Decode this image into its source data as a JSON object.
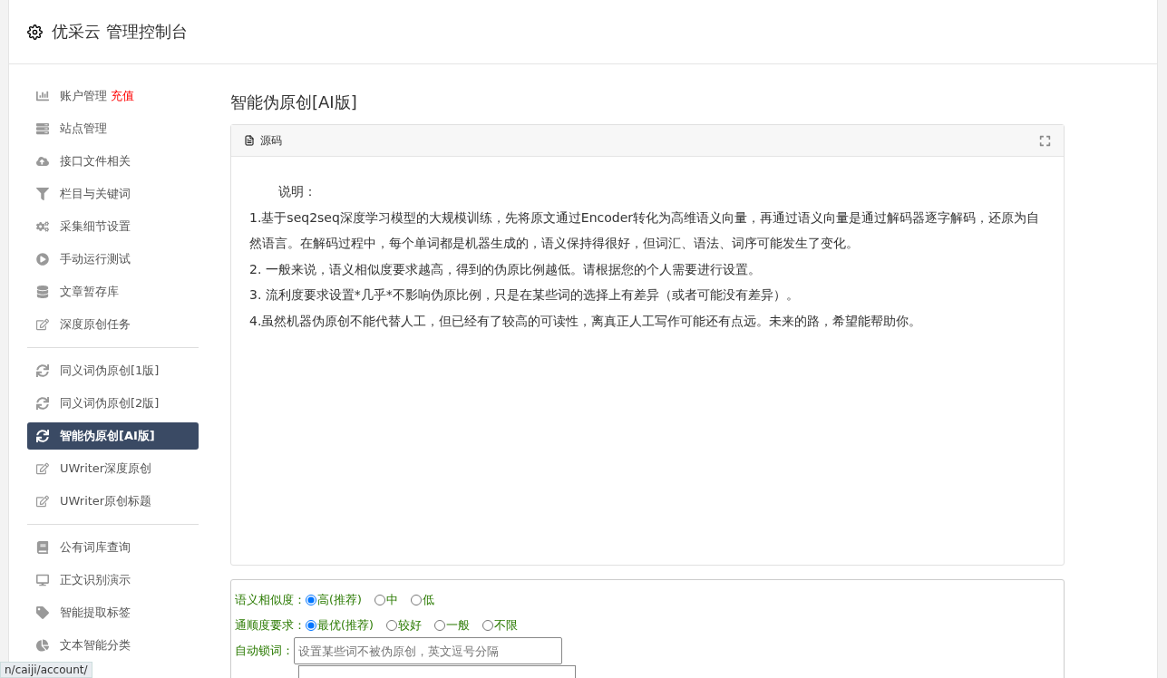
{
  "header": {
    "title": "优采云 管理控制台"
  },
  "sidebar": {
    "groups": [
      {
        "items": [
          {
            "label": "账户管理",
            "badge": "充值",
            "selected": false
          },
          {
            "label": "站点管理",
            "selected": false
          },
          {
            "label": "接口文件相关",
            "selected": false
          },
          {
            "label": "栏目与关键词",
            "selected": false
          },
          {
            "label": "采集细节设置",
            "selected": false
          },
          {
            "label": "手动运行测试",
            "selected": false
          },
          {
            "label": "文章暂存库",
            "selected": false
          },
          {
            "label": "深度原创任务",
            "selected": false
          }
        ]
      },
      {
        "items": [
          {
            "label": "同义词伪原创[1版]",
            "selected": false
          },
          {
            "label": "同义词伪原创[2版]",
            "selected": false
          },
          {
            "label": "智能伪原创[AI版]",
            "selected": true
          },
          {
            "label": "UWriter深度原创",
            "selected": false
          },
          {
            "label": "UWriter原创标题",
            "selected": false
          }
        ]
      },
      {
        "items": [
          {
            "label": "公有词库查询",
            "selected": false
          },
          {
            "label": "正文识别演示",
            "selected": false
          },
          {
            "label": "智能提取标签",
            "selected": false
          },
          {
            "label": "文本智能分类",
            "selected": false
          }
        ]
      }
    ]
  },
  "page_title": "智能伪原创[AI版]",
  "editor": {
    "tab": "源码",
    "lines": [
      "说明：",
      "1.基于seq2seq深度学习模型的大规模训练，先将原文通过Encoder转化为高维语义向量，再通过语义向量是通过解码器逐字解码，还原为自然语言。在解码过程中，每个单词都是机器生成的，语义保持得很好，但词汇、语法、词序可能发生了变化。",
      "2. 一般来说，语义相似度要求越高，得到的伪原比例越低。请根据您的个人需要进行设置。",
      "3. 流利度要求设置*几乎*不影响伪原比例，只是在某些词的选择上有差异（或者可能没有差异）。",
      "4.虽然机器伪原创不能代替人工，但已经有了较高的可读性，离真正人工写作可能还有点远。未来的路，希望能帮助你。"
    ]
  },
  "form": {
    "similarity": {
      "label": "语义相似度：",
      "options": [
        {
          "label": "高(推荐)",
          "selected": true
        },
        {
          "label": "中",
          "selected": false
        },
        {
          "label": "低",
          "selected": false
        }
      ]
    },
    "fluency": {
      "label": "通顺度要求：",
      "options": [
        {
          "label": "最优(推荐)",
          "selected": true
        },
        {
          "label": "较好",
          "selected": false
        },
        {
          "label": "一般",
          "selected": false
        },
        {
          "label": "不限",
          "selected": false
        }
      ]
    },
    "lock_words": {
      "label": "自动锁词：",
      "placeholder": "设置某些词不被伪原创，英文逗号分隔"
    }
  },
  "status_bar": {
    "url": "n/caiji/account/"
  }
}
